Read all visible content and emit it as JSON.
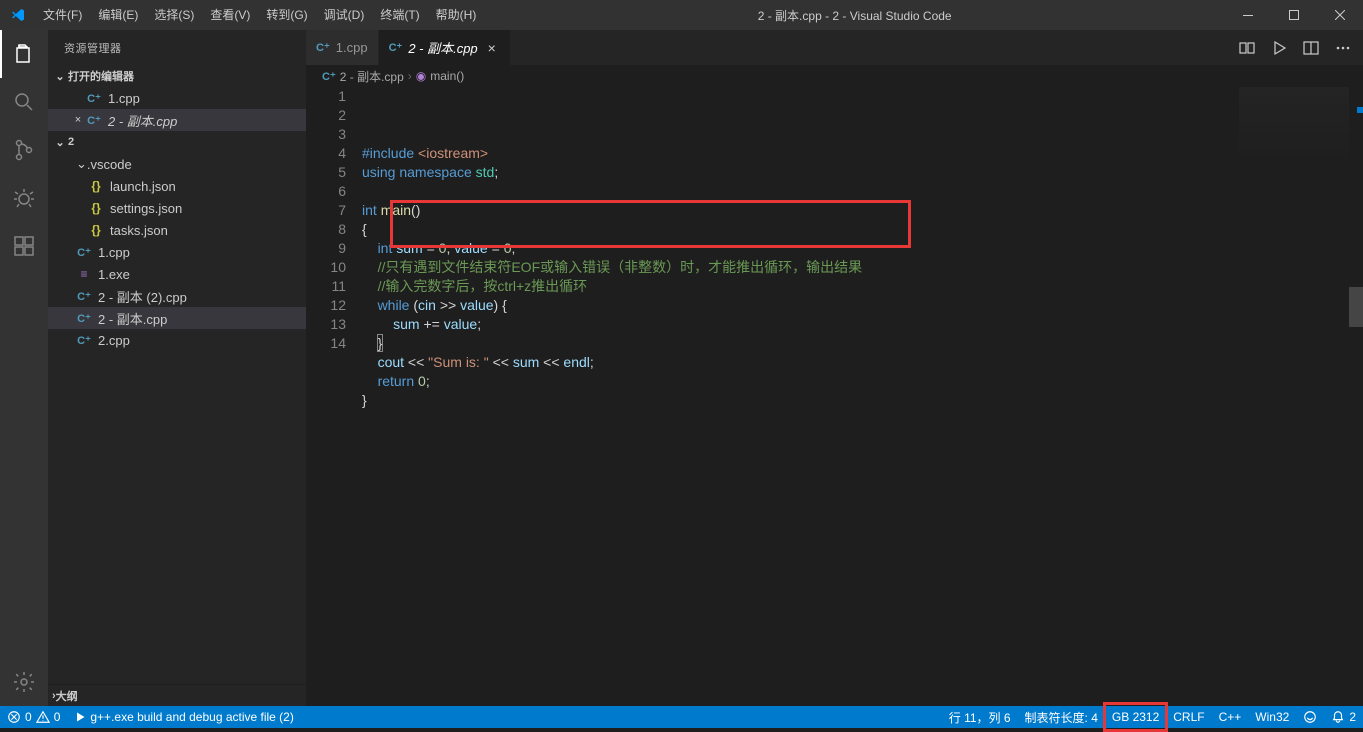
{
  "window": {
    "title": "2 - 副本.cpp - 2 - Visual Studio Code"
  },
  "menu": {
    "file": "文件(F)",
    "edit": "编辑(E)",
    "selection": "选择(S)",
    "view": "查看(V)",
    "go": "转到(G)",
    "debug": "调试(D)",
    "terminal": "终端(T)",
    "help": "帮助(H)"
  },
  "sidebar": {
    "title": "资源管理器",
    "open_editors": "打开的编辑器",
    "editors": [
      {
        "label": "1.cpp",
        "dirty": false,
        "italic": false
      },
      {
        "label": "2 - 副本.cpp",
        "dirty": false,
        "italic": true,
        "active": true,
        "close": "×"
      }
    ],
    "workspace": "2",
    "folders": [
      {
        "name": ".vscode",
        "children": [
          {
            "label": "launch.json",
            "icon": "json"
          },
          {
            "label": "settings.json",
            "icon": "json"
          },
          {
            "label": "tasks.json",
            "icon": "json"
          }
        ]
      }
    ],
    "files": [
      {
        "label": "1.cpp",
        "icon": "cpp"
      },
      {
        "label": "1.exe",
        "icon": "exe"
      },
      {
        "label": "2 - 副本 (2).cpp",
        "icon": "cpp"
      },
      {
        "label": "2 - 副本.cpp",
        "icon": "cpp",
        "selected": true
      },
      {
        "label": "2.cpp",
        "icon": "cpp"
      }
    ],
    "outline": "大纲"
  },
  "tabs": [
    {
      "label": "1.cpp",
      "active": false
    },
    {
      "label": "2 - 副本.cpp",
      "active": true,
      "italic": true
    }
  ],
  "breadcrumb": {
    "file": "2 - 副本.cpp",
    "symbol": "main()"
  },
  "code": {
    "lines": [
      {
        "n": 1,
        "tokens": [
          [
            "#include ",
            "kw"
          ],
          [
            "<iostream>",
            "str"
          ]
        ]
      },
      {
        "n": 2,
        "tokens": [
          [
            "using ",
            "kw"
          ],
          [
            "namespace ",
            "kw"
          ],
          [
            "std",
            "ns"
          ],
          [
            ";",
            "punct"
          ]
        ]
      },
      {
        "n": 3,
        "tokens": [
          [
            "",
            ""
          ]
        ]
      },
      {
        "n": 4,
        "tokens": [
          [
            "int ",
            "type"
          ],
          [
            "main",
            "fn"
          ],
          [
            "()",
            "punct"
          ]
        ]
      },
      {
        "n": 5,
        "tokens": [
          [
            "{",
            "punct"
          ]
        ]
      },
      {
        "n": 6,
        "tokens": [
          [
            "    ",
            ""
          ],
          [
            "int ",
            "type"
          ],
          [
            "sum",
            "id"
          ],
          [
            " = ",
            "op"
          ],
          [
            "0",
            "num"
          ],
          [
            ", ",
            "punct"
          ],
          [
            "value",
            "id"
          ],
          [
            " = ",
            "op"
          ],
          [
            "0",
            "num"
          ],
          [
            ";",
            "punct"
          ]
        ]
      },
      {
        "n": 7,
        "tokens": [
          [
            "    ",
            ""
          ],
          [
            "//只有遇到文件结束符EOF或输入错误（非整数）时，才能推出循环，输出结果",
            "cmt"
          ]
        ]
      },
      {
        "n": 8,
        "tokens": [
          [
            "    ",
            ""
          ],
          [
            "//输入完数字后，按ctrl+z推出循环",
            "cmt"
          ]
        ]
      },
      {
        "n": 9,
        "tokens": [
          [
            "    ",
            ""
          ],
          [
            "while ",
            "kw"
          ],
          [
            "(",
            "punct"
          ],
          [
            "cin",
            "id"
          ],
          [
            " >> ",
            "op"
          ],
          [
            "value",
            "id"
          ],
          [
            ")",
            "punct"
          ],
          [
            " {",
            "punct"
          ]
        ]
      },
      {
        "n": 10,
        "tokens": [
          [
            "        ",
            ""
          ],
          [
            "sum",
            "id"
          ],
          [
            " += ",
            "op"
          ],
          [
            "value",
            "id"
          ],
          [
            ";",
            "punct"
          ]
        ]
      },
      {
        "n": 11,
        "tokens": [
          [
            "    ",
            ""
          ],
          [
            "}",
            "punct brace-match"
          ]
        ]
      },
      {
        "n": 12,
        "tokens": [
          [
            "    ",
            ""
          ],
          [
            "cout",
            "id"
          ],
          [
            " << ",
            "op"
          ],
          [
            "\"Sum is: \"",
            "str"
          ],
          [
            " << ",
            "op"
          ],
          [
            "sum",
            "id"
          ],
          [
            " << ",
            "op"
          ],
          [
            "endl",
            "id"
          ],
          [
            ";",
            "punct"
          ]
        ]
      },
      {
        "n": 13,
        "tokens": [
          [
            "    ",
            ""
          ],
          [
            "return ",
            "kw"
          ],
          [
            "0",
            "num"
          ],
          [
            ";",
            "punct"
          ]
        ]
      },
      {
        "n": 14,
        "tokens": [
          [
            "}",
            "punct"
          ]
        ]
      }
    ]
  },
  "status": {
    "errors": "0",
    "warnings": "0",
    "build": "g++.exe build and debug active file (2)",
    "cursor": "行 11，列 6",
    "tabsize": "制表符长度: 4",
    "encoding": "GB 2312",
    "eol": "CRLF",
    "lang": "C++",
    "platform": "Win32",
    "notif": "2"
  }
}
